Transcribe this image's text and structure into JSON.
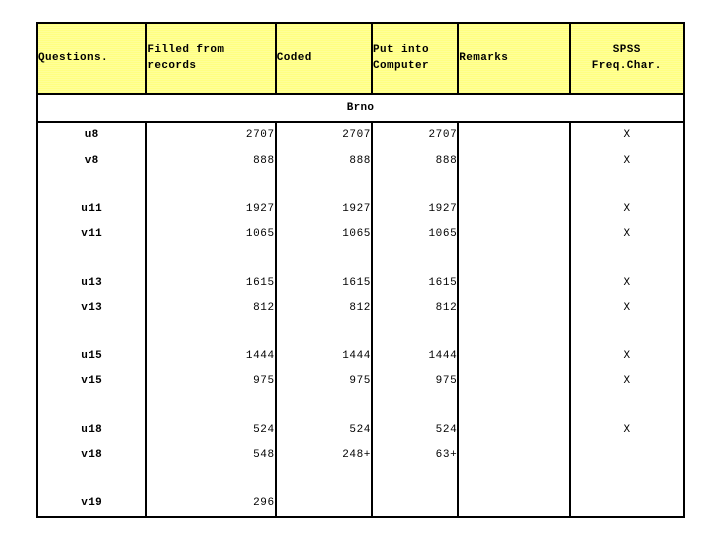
{
  "table": {
    "columns": [
      {
        "id": "questions",
        "label": "Questions."
      },
      {
        "id": "filled_from_records",
        "label": "Filled from\nrecords",
        "line1": "Filled from",
        "line2": "records"
      },
      {
        "id": "coded",
        "label": "Coded"
      },
      {
        "id": "put_into_computer",
        "label": "Put into\nComputer",
        "line1": "Put into",
        "line2": "Computer"
      },
      {
        "id": "remarks",
        "label": "Remarks"
      },
      {
        "id": "spss_freq_char",
        "label": "SPSS\nFreq.Char.",
        "line1": "SPSS",
        "line2": "Freq.Char."
      }
    ],
    "group_label": "Brno",
    "rows": [
      {
        "type": "data",
        "question": "u8",
        "filled": "2707",
        "coded": "2707",
        "computer": "2707",
        "remarks": "",
        "spss": "X"
      },
      {
        "type": "data",
        "question": "v8",
        "filled": "888",
        "coded": "888",
        "computer": "888",
        "remarks": "",
        "spss": "X"
      },
      {
        "type": "spacer",
        "question": "",
        "filled": "",
        "coded": "",
        "computer": "",
        "remarks": "",
        "spss": ""
      },
      {
        "type": "data",
        "question": "u11",
        "filled": "1927",
        "coded": "1927",
        "computer": "1927",
        "remarks": "",
        "spss": "X"
      },
      {
        "type": "data",
        "question": "v11",
        "filled": "1065",
        "coded": "1065",
        "computer": "1065",
        "remarks": "",
        "spss": "X"
      },
      {
        "type": "spacer",
        "question": "",
        "filled": "",
        "coded": "",
        "computer": "",
        "remarks": "",
        "spss": ""
      },
      {
        "type": "data",
        "question": "u13",
        "filled": "1615",
        "coded": "1615",
        "computer": "1615",
        "remarks": "",
        "spss": "X"
      },
      {
        "type": "data",
        "question": "v13",
        "filled": "812",
        "coded": "812",
        "computer": "812",
        "remarks": "",
        "spss": "X"
      },
      {
        "type": "spacer",
        "question": "",
        "filled": "",
        "coded": "",
        "computer": "",
        "remarks": "",
        "spss": ""
      },
      {
        "type": "data",
        "question": "u15",
        "filled": "1444",
        "coded": "1444",
        "computer": "1444",
        "remarks": "",
        "spss": "X"
      },
      {
        "type": "data",
        "question": "v15",
        "filled": "975",
        "coded": "975",
        "computer": "975",
        "remarks": "",
        "spss": "X"
      },
      {
        "type": "spacer",
        "question": "",
        "filled": "",
        "coded": "",
        "computer": "",
        "remarks": "",
        "spss": ""
      },
      {
        "type": "data",
        "question": "u18",
        "filled": "524",
        "coded": "524",
        "computer": "524",
        "remarks": "",
        "spss": "X"
      },
      {
        "type": "data",
        "question": "v18",
        "filled": "548",
        "coded": "248+",
        "computer": "63+",
        "remarks": "",
        "spss": ""
      },
      {
        "type": "spacer",
        "question": "",
        "filled": "",
        "coded": "",
        "computer": "",
        "remarks": "",
        "spss": ""
      },
      {
        "type": "data",
        "question": "v19",
        "filled": "296",
        "coded": "",
        "computer": "",
        "remarks": "",
        "spss": ""
      }
    ]
  },
  "colors": {
    "header_background": "#FFFF99",
    "border": "#000000",
    "page_background": "#FFFFFF",
    "text": "#000000"
  }
}
